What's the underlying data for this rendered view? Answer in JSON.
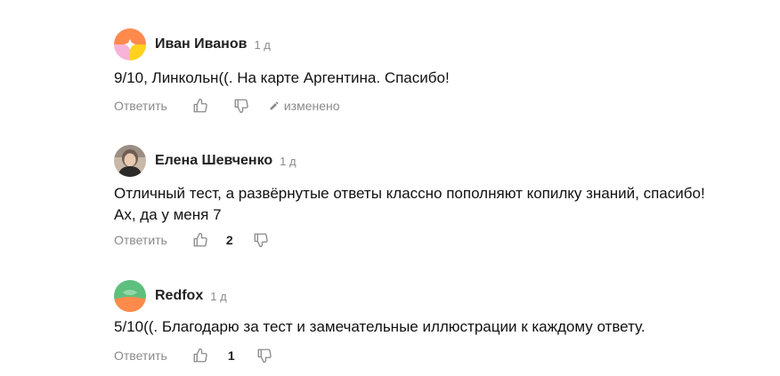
{
  "comments": [
    {
      "author": "Иван Иванов",
      "time": "1 д",
      "text": "9/10, Линкольн((. На карте Аргентина. Спасибо!",
      "reply": "Ответить",
      "likes": "",
      "edited": "изменено",
      "avatar": "orange-pink-yellow"
    },
    {
      "author": "Елена Шевченко",
      "time": "1 д",
      "text": "Отличный тест, а развёрнутые ответы классно пополняют копилку знаний, спасибо!\nАх, да у меня 7",
      "reply": "Ответить",
      "likes": "2",
      "edited": "",
      "avatar": "photo"
    },
    {
      "author": "Redfox",
      "time": "1 д",
      "text": "5/10((. Благодарю за тест и замечательные иллюстрации к каждому ответу.",
      "reply": "Ответить",
      "likes": "1",
      "edited": "",
      "avatar": "green-orange"
    }
  ]
}
